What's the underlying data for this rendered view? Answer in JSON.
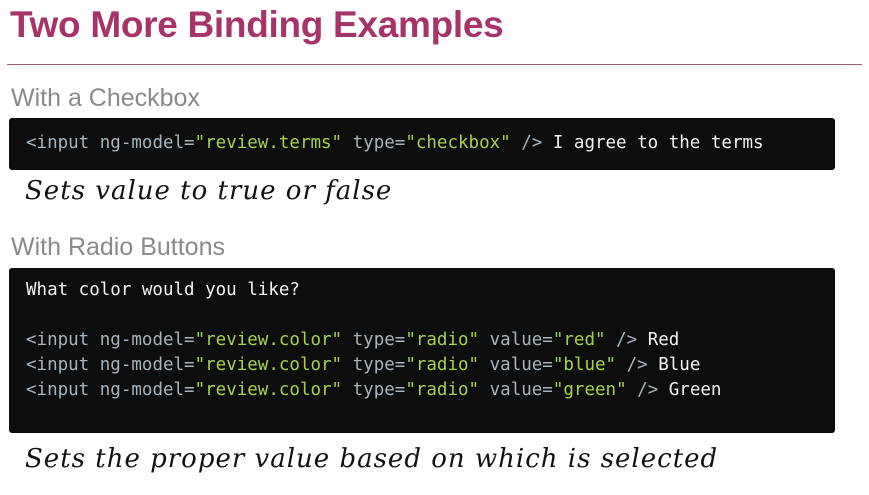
{
  "slide": {
    "title": "Two More Binding Examples"
  },
  "checkbox_section": {
    "heading": "With a Checkbox",
    "code": {
      "open": "<input ",
      "attr1": "ng-model=",
      "val1": "\"review.terms\"",
      "attr2": " type=",
      "val2": "\"checkbox\"",
      "close": " />",
      "text": " I agree to the terms"
    },
    "note": "Sets value to true or false"
  },
  "radio_section": {
    "heading": "With Radio Buttons",
    "question": "What color would you like?",
    "lines": [
      {
        "open": "<input ",
        "attr1": "ng-model=",
        "val1": "\"review.color\"",
        "attr2": " type=",
        "val2": "\"radio\"",
        "attr3": " value=",
        "val3": "\"red\"",
        "close": " />",
        "text": " Red"
      },
      {
        "open": "<input ",
        "attr1": "ng-model=",
        "val1": "\"review.color\"",
        "attr2": " type=",
        "val2": "\"radio\"",
        "attr3": " value=",
        "val3": "\"blue\"",
        "close": " />",
        "text": " Blue"
      },
      {
        "open": "<input ",
        "attr1": "ng-model=",
        "val1": "\"review.color\"",
        "attr2": " type=",
        "val2": "\"radio\"",
        "attr3": " value=",
        "val3": "\"green\"",
        "close": " />",
        "text": " Green"
      }
    ],
    "note": "Sets the proper value based on which is selected"
  },
  "colors": {
    "title": "#a7336b",
    "code_background": "#0d0d0d",
    "code_string": "#a6d14f",
    "code_keyword": "#a5b4bd",
    "heading_gray": "#8a8a8a"
  }
}
